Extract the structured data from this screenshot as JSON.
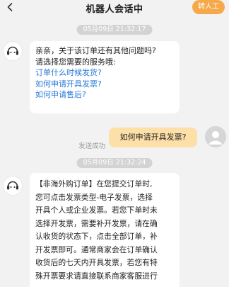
{
  "header": {
    "title": "机器人会话中",
    "transfer_label": "转人工"
  },
  "messages": {
    "time1": "05月09日 21:32:17",
    "bot1": {
      "line1": "亲亲，关于该订单还有其他问题吗?",
      "line2": "请选择您需要的服务哦:",
      "options": [
        "订单什么时候发货?",
        "如何申请开具发票?",
        "如何申请售后?"
      ]
    },
    "user1": "如何申请开具发票?",
    "user1_status": "发送成功",
    "time2": "05月09日 21:32:24",
    "bot2": {
      "lines": [
        "【非海外购订单】在您提交订单时,",
        "您可点击发票类型-电子发票，选择",
        "开具个人或企业发票。若您下单时未",
        "选择开发票，需要补开发票，请在确",
        "认收货的状态下，点击全部订单，补",
        "开发票即可。通常商家会在订单确认",
        "收货后的七天内开具发票，若您有特",
        "殊开票要求请直接联系商家客服进行"
      ]
    }
  },
  "icons": {
    "back": "chevron-left-icon",
    "bot_avatar": "headset-icon",
    "user_avatar": "person-icon"
  },
  "colors": {
    "transfer_button": "#f6a94a",
    "user_bubble": "#fde0a8",
    "link": "#2a79d8",
    "time_pill": "#d3d3d3"
  }
}
